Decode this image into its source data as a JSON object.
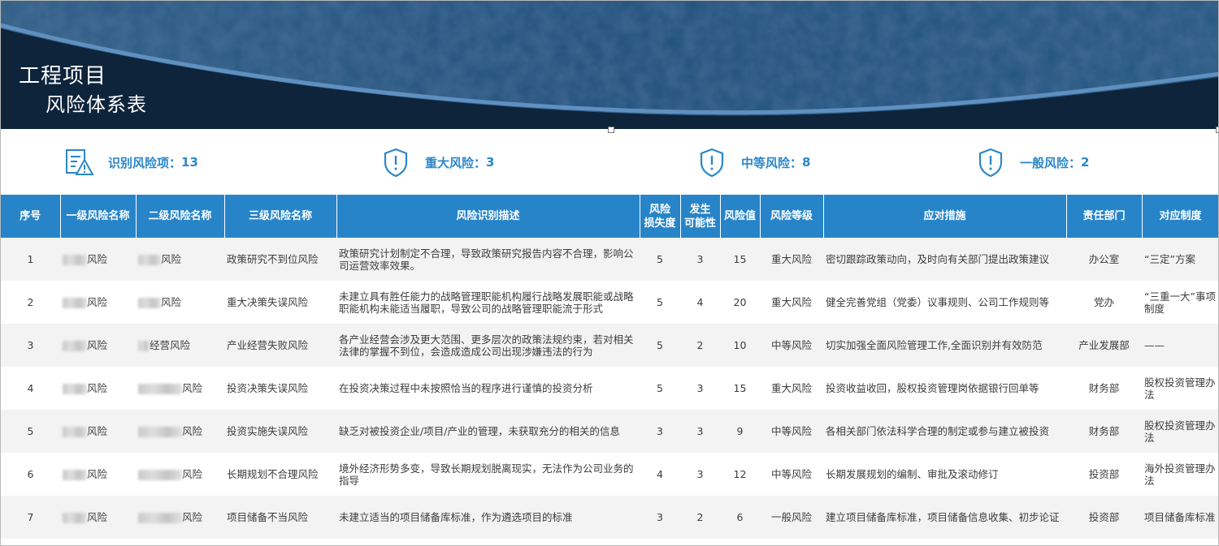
{
  "banner": {
    "title_line1": "工程项目",
    "title_line2": "风险体系表"
  },
  "summary": {
    "identified": {
      "label": "识别风险项：",
      "value": "13",
      "icon": "report-warning-icon"
    },
    "major": {
      "label": "重大风险：",
      "value": "3",
      "icon": "shield-alert-icon"
    },
    "medium": {
      "label": "中等风险：",
      "value": "8",
      "icon": "shield-alert-icon"
    },
    "general": {
      "label": "一般风险：",
      "value": "2",
      "icon": "shield-alert-icon"
    }
  },
  "colors": {
    "accent": "#2784c8",
    "text_accent": "#2b87c8",
    "banner": "#0f2942"
  },
  "table": {
    "headers": {
      "seq": "序号",
      "level1": "一级风险名称",
      "level2": "二级风险名称",
      "level3": "三级风险名称",
      "desc": "风险识别描述",
      "loss_a": "风险",
      "loss_b": "损失度",
      "prob_a": "发生",
      "prob_b": "可能性",
      "value": "风险值",
      "grade": "风险等级",
      "measures": "应对措施",
      "dept": "责任部门",
      "policy": "对应制度"
    },
    "rows": [
      {
        "seq": "1",
        "l1": "风险",
        "l2": "风险",
        "l3": "政策研究不到位风险",
        "desc": "政策研究计划制定不合理，导致政策研究报告内容不合理，影响公司运营效率效果。",
        "loss": "5",
        "prob": "3",
        "val": "15",
        "grade": "重大风险",
        "measure": "密切跟踪政策动向，及时向有关部门提出政策建议",
        "dept": "办公室",
        "policy": "“三定”方案"
      },
      {
        "seq": "2",
        "l1": "风险",
        "l2": "风险",
        "l3": "重大决策失误风险",
        "desc": "未建立具有胜任能力的战略管理职能机构履行战略发展职能或战略职能机构未能适当履职，导致公司的战略管理职能流于形式",
        "loss": "5",
        "prob": "4",
        "val": "20",
        "grade": "重大风险",
        "measure": "健全完善党组（党委）议事规则、公司工作规则等",
        "dept": "党办",
        "policy": "“三重一大”事项制度"
      },
      {
        "seq": "3",
        "l1": "风险",
        "l2": "经营风险",
        "l3": "产业经营失败风险",
        "desc": "各产业经营会涉及更大范围、更多层次的政策法规约束，若对相关法律的掌握不到位，会造成造成公司出现涉嫌违法的行为",
        "loss": "5",
        "prob": "2",
        "val": "10",
        "grade": "中等风险",
        "measure": "切实加强全面风险管理工作,全面识别并有效防范",
        "dept": "产业发展部",
        "policy": "——"
      },
      {
        "seq": "4",
        "l1": "风险",
        "l2": "风险",
        "l3": "投资决策失误风险",
        "desc": "在投资决策过程中未按照恰当的程序进行谨慎的投资分析",
        "loss": "5",
        "prob": "3",
        "val": "15",
        "grade": "重大风险",
        "measure": "投资收益收回，股权投资管理岗依据银行回单等",
        "dept": "财务部",
        "policy": "股权投资管理办法"
      },
      {
        "seq": "5",
        "l1": "风险",
        "l2": "风险",
        "l3": "投资实施失误风险",
        "desc": "缺乏对被投资企业/项目/产业的管理，未获取充分的相关的信息",
        "loss": "3",
        "prob": "3",
        "val": "9",
        "grade": "中等风险",
        "measure": "各相关部门依法科学合理的制定或参与建立被投资",
        "dept": "财务部",
        "policy": "股权投资管理办法"
      },
      {
        "seq": "6",
        "l1": "风险",
        "l2": "风险",
        "l3": "长期规划不合理风险",
        "desc": "境外经济形势多变，导致长期规划脱离现实，无法作为公司业务的指导",
        "loss": "4",
        "prob": "3",
        "val": "12",
        "grade": "中等风险",
        "measure": "长期发展规划的编制、审批及滚动修订",
        "dept": "投资部",
        "policy": "海外投资管理办法"
      },
      {
        "seq": "7",
        "l1": "风险",
        "l2": "风险",
        "l3": "项目储备不当风险",
        "desc": "未建立适当的项目储备库标准，作为遴选项目的标准",
        "loss": "3",
        "prob": "2",
        "val": "6",
        "grade": "一般风险",
        "measure": "建立项目储备库标准，项目储备信息收集、初步论证",
        "dept": "投资部",
        "policy": "项目储备库标准"
      }
    ]
  }
}
